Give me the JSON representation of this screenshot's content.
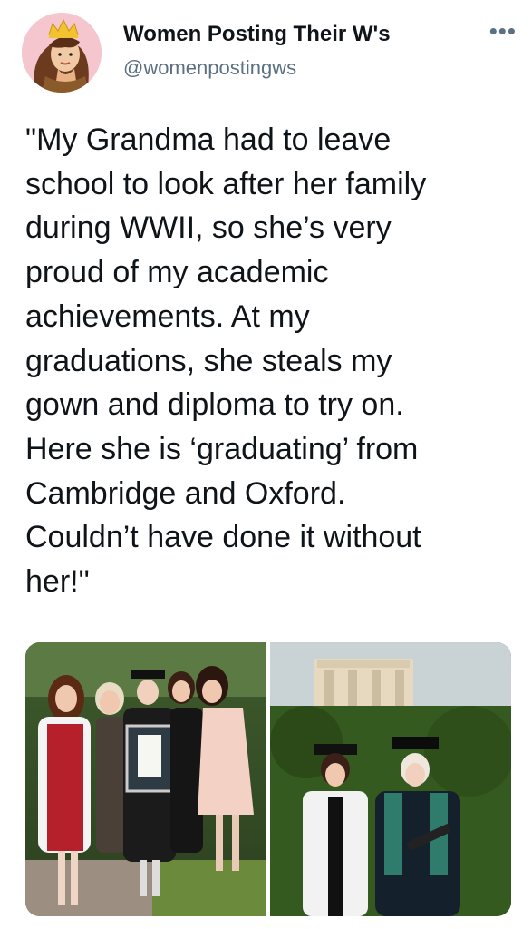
{
  "account": {
    "display_name": "Women Posting Their W's",
    "handle": "@womenpostingws",
    "avatar_icon": "crowned-woman-avatar-icon"
  },
  "more_icon": "more-options-icon",
  "tweet": {
    "text": "\"My Grandma had to leave\nschool to look after her family\nduring WWII, so she’s very\nproud of my academic\nachievements. At my\ngraduations, she steals my\ngown and diploma to try on.\nHere she is ‘graduating’ from\nCambridge and Oxford.\nCouldn’t have done it without\nher!\""
  },
  "media": {
    "photos": [
      {
        "label": "family-graduation-photo"
      },
      {
        "label": "oxford-graduation-photo"
      }
    ]
  },
  "colors": {
    "text": "#0f1419",
    "secondary_text": "#5b7083",
    "avatar_bg": "#f6c6cf"
  }
}
